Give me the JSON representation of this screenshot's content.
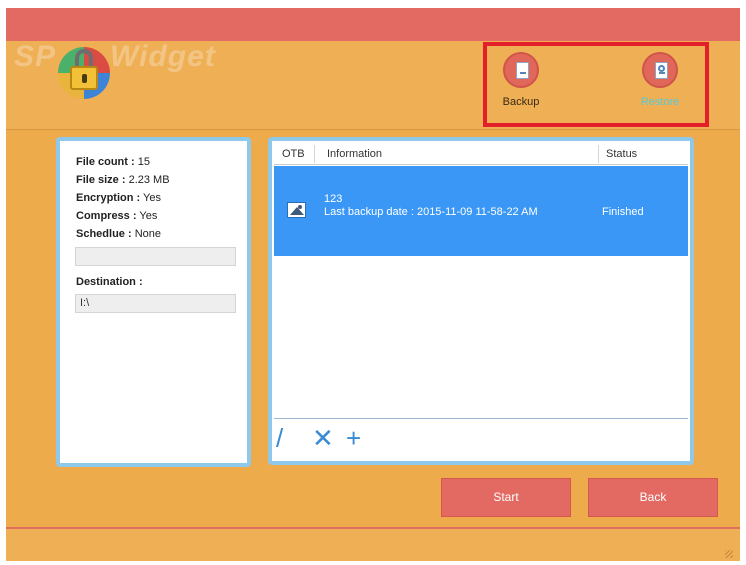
{
  "app": {
    "logo_text_left": "SP",
    "logo_text_right": "Widget",
    "colors": {
      "titlebar": "#e36a62",
      "background": "#edab4c",
      "highlight": "#e3202a",
      "selection": "#3a97f5",
      "panel_border": "#8ec8ea"
    }
  },
  "toolbar": {
    "backup_label": "Backup",
    "restore_label": "Restore"
  },
  "summary": {
    "file_count_label": "File count :",
    "file_count_value": "15",
    "file_size_label": "File size :",
    "file_size_value": "2.23 MB",
    "encryption_label": "Encryption :",
    "encryption_value": "Yes",
    "compress_label": "Compress :",
    "compress_value": "Yes",
    "schedule_label": "Schedlue :",
    "schedule_value": "None",
    "schedule_field_value": "",
    "destination_label": "Destination :",
    "destination_value": "I:\\"
  },
  "table": {
    "columns": [
      "OTB",
      "Information",
      "Status"
    ],
    "rows": [
      {
        "icon": "image-icon",
        "name": "123",
        "info": "Last backup date : 2015-11-09 11-58-22 AM",
        "status": "Finished"
      }
    ]
  },
  "table_tools": {
    "edit": "/",
    "delete": "✕",
    "add": "+"
  },
  "actions": {
    "start_label": "Start",
    "back_label": "Back"
  }
}
